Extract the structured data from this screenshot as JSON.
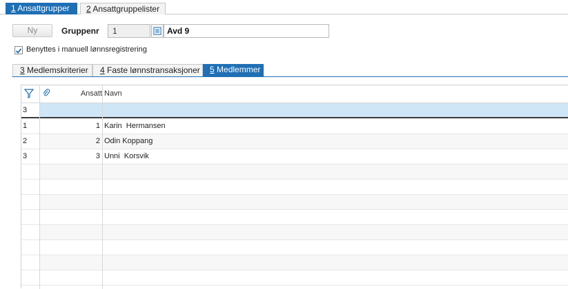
{
  "top_tabs": [
    {
      "key": "1",
      "label": " Ansattgrupper",
      "active": true
    },
    {
      "key": "2",
      "label": " Ansattgruppelister",
      "active": false
    }
  ],
  "form": {
    "new_button": "Ny",
    "group_label": "Gruppenr",
    "group_number": "1",
    "group_name": "Avd 9",
    "checkbox_label": "Benyttes i manuell lønnsregistrering",
    "checkbox_checked": true
  },
  "inner_tabs": [
    {
      "key": "3",
      "label": " Medlemskriterier",
      "active": false
    },
    {
      "key": "4",
      "label": " Faste lønnstransaksjoner",
      "active": false
    },
    {
      "key": "5",
      "label": " Medlemmer",
      "active": true
    }
  ],
  "grid": {
    "columns": {
      "ansatt": "Ansatt",
      "navn": "Navn"
    },
    "filter_row": {
      "count": "3"
    },
    "rows": [
      {
        "num": "1",
        "ansatt": "1",
        "navn": "Karin  Hermansen"
      },
      {
        "num": "2",
        "ansatt": "2",
        "navn": "Odin Koppang"
      },
      {
        "num": "3",
        "ansatt": "3",
        "navn": "Unni  Korsvik"
      }
    ]
  },
  "colors": {
    "accent": "#1f6fb5",
    "filter_row": "#cfe6f7"
  }
}
